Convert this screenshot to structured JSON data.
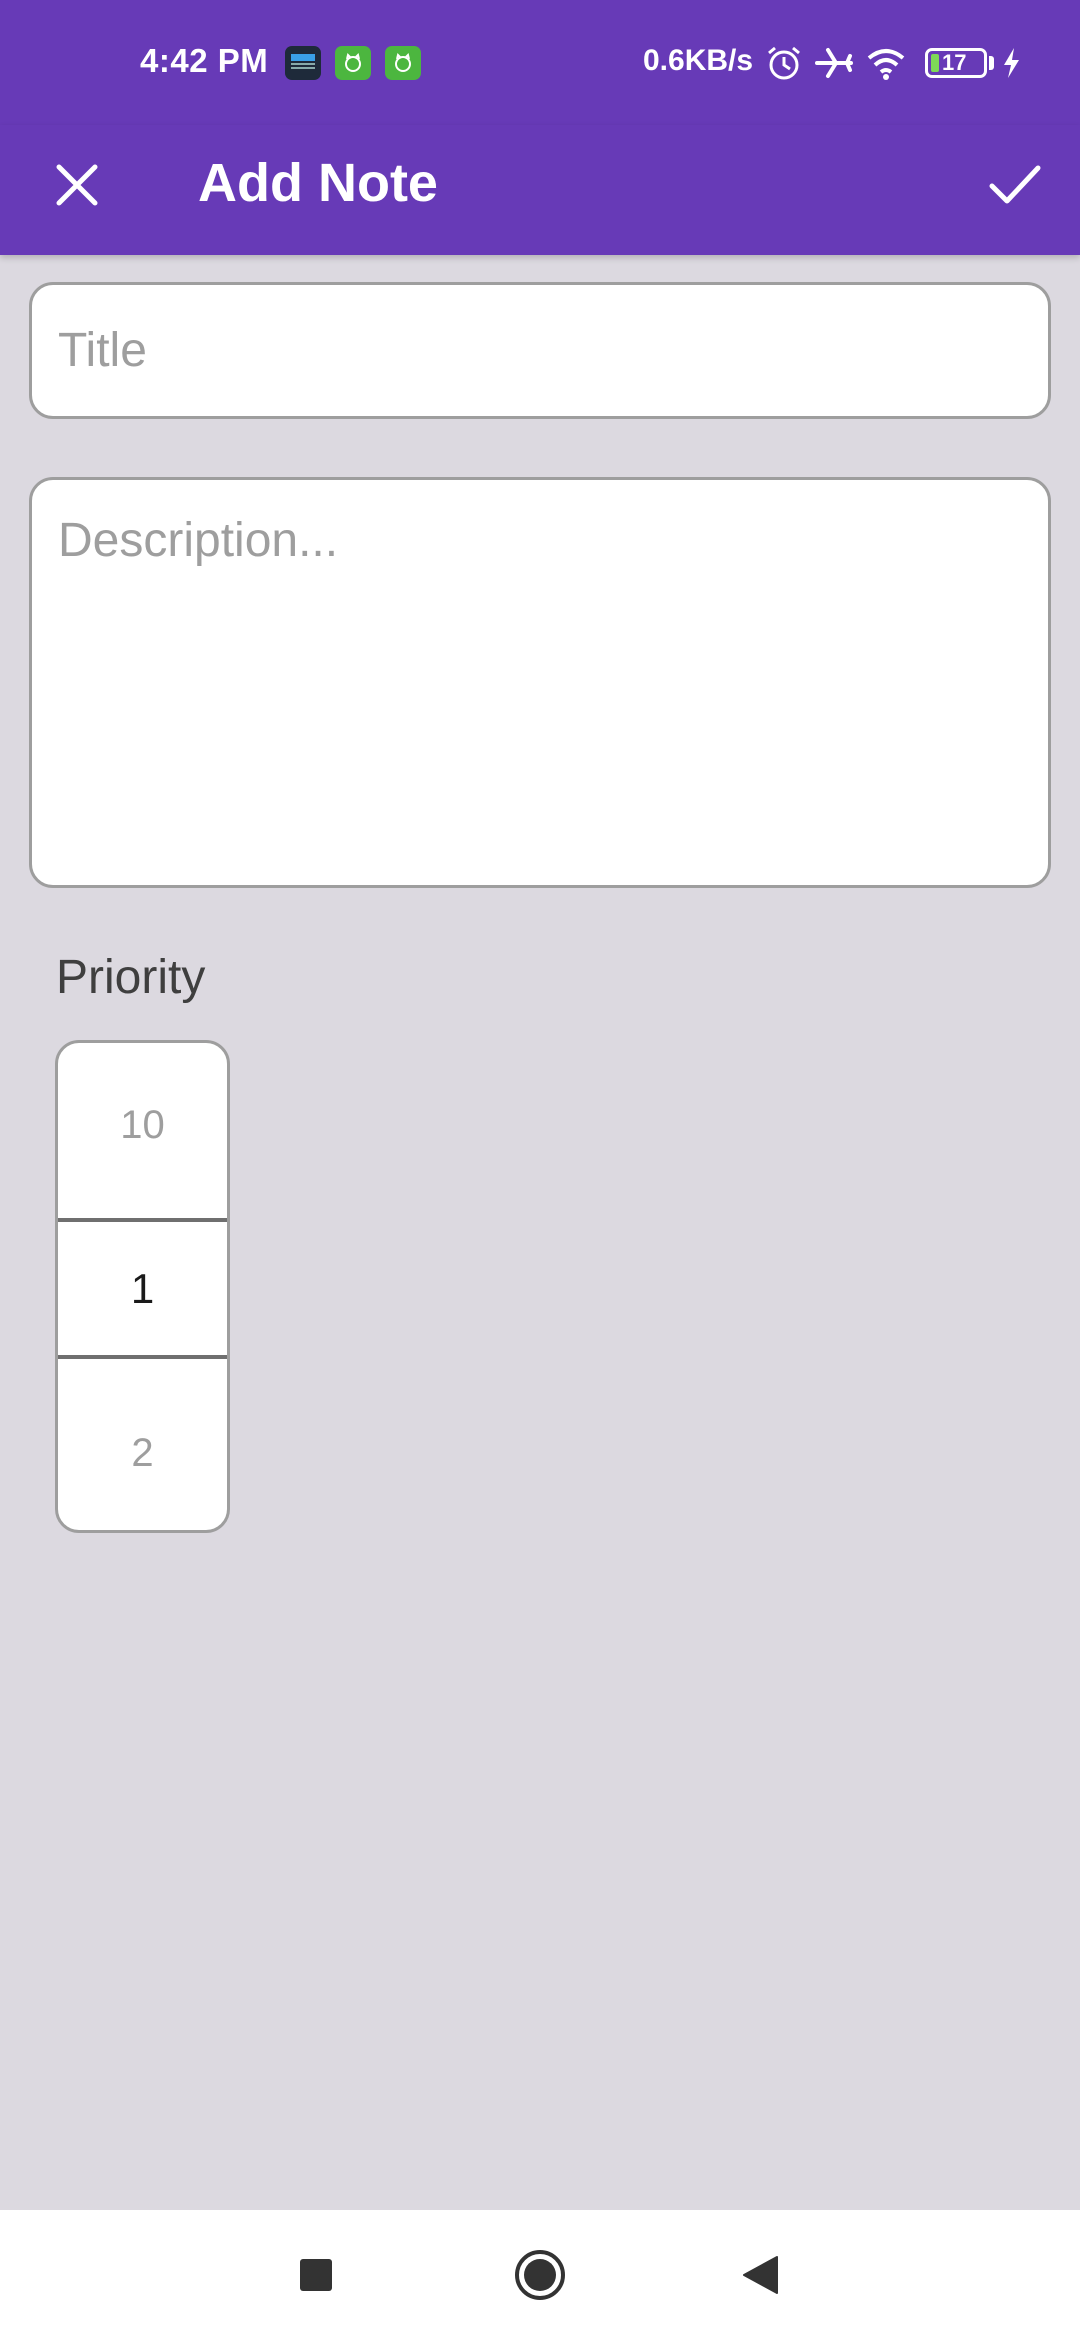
{
  "status_bar": {
    "time": "4:42 PM",
    "network_speed": "0.6KB/s",
    "battery_level": "17",
    "icons": [
      "app-365-icon",
      "cat-app-icon",
      "cat-app-icon",
      "alarm-icon",
      "airplane-icon",
      "wifi-icon",
      "battery-icon",
      "charging-icon"
    ]
  },
  "app_bar": {
    "title": "Add Note",
    "close_icon": "close-icon",
    "save_icon": "check-icon"
  },
  "form": {
    "title_placeholder": "Title",
    "title_value": "",
    "description_placeholder": "Description...",
    "description_value": ""
  },
  "priority": {
    "label": "Priority",
    "previous": "10",
    "selected": "1",
    "next": "2"
  },
  "nav_bar": {
    "icons": [
      "recents-icon",
      "home-icon",
      "back-icon"
    ]
  },
  "colors": {
    "primary": "#673ab7",
    "background": "#dcd9e0"
  }
}
